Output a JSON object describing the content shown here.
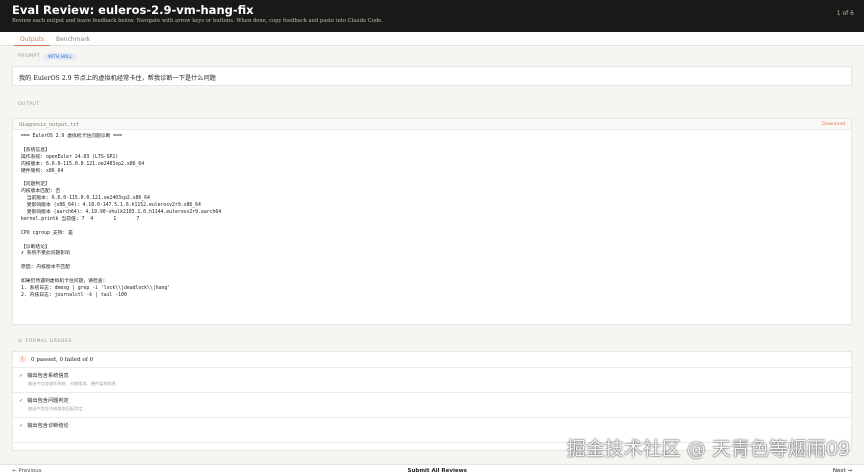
{
  "header": {
    "title": "Eval Review: euleros-2.9-vm-hang-fix",
    "subtitle": "Review each output and leave feedback below. Navigate with arrow keys or buttons. When done, copy feedback and paste into Claude Code.",
    "counter": "1 of 6"
  },
  "tabs": [
    {
      "label": "Outputs",
      "active": true
    },
    {
      "label": "Benchmark",
      "active": false
    }
  ],
  "prompt": {
    "label": "PROMPT",
    "badge": "WITH SKILL",
    "text": "我的 EulerOS 2.9 节点上的虚拟机经常卡住，帮我诊断一下是什么问题"
  },
  "output": {
    "label": "OUTPUT",
    "file_name": "diagnosis_output.txt",
    "download_label": "Download",
    "code": "=== EulerOS 2.9 虚拟机卡住问题诊断 ===\n\n【系统信息】\n操作系统: openEuler 24.03 (LTS-SP2)\n内核版本: 6.6.0-115.0.0.121.oe2403sp2.x86_64\n硬件架构: x86_64\n\n【问题判定】\n内核版本匹配: 否\n  当前版本: 6.6.0-115.0.0.121.oe2403sp2.x86_64\n  受影响版本 (x86_64): 4.18.0-147.5.1.6.h1152.eulerosv2r9.x86_64\n  受影响版本 (aarch64): 4.19.90-vhulk2103.1.0.h1144.eulerosv2r9.aarch64\nkernel.printk 当前值: 7  4       1       7\n\nCPU cgroup 支持: 是\n\n【诊断结论】\n✗ 系统不受此问题影响\n\n原因: 内核版本不匹配\n\n如果仍然遇到虚拟机卡住问题，请检查:\n1. 系统日志: dmesg | grep -i 'lock\\\\|deadlock\\\\|hang'\n2. 内核日志: journalctl -k | tail -100"
  },
  "grades": {
    "label": "FORMAL GRADES",
    "summary": "0 passed, 0 failed of 0",
    "items": [
      {
        "title": "输出包含系统信息",
        "detail": "输出中包含操作系统、内核版本、硬件架构信息"
      },
      {
        "title": "输出包含问题判定",
        "detail": "输出中包含内核版本匹配判定"
      },
      {
        "title": "输出包含诊断结论",
        "detail": ""
      }
    ]
  },
  "footer": {
    "previous": "← Previous",
    "submit": "Submit All Reviews",
    "next": "Next →"
  },
  "watermark": "掘金技术社区 @ 天青色等烟雨09",
  "colors": {
    "accent": "#d97757",
    "header_bg": "#1a1917",
    "badge_bg": "#dfe9f8"
  }
}
